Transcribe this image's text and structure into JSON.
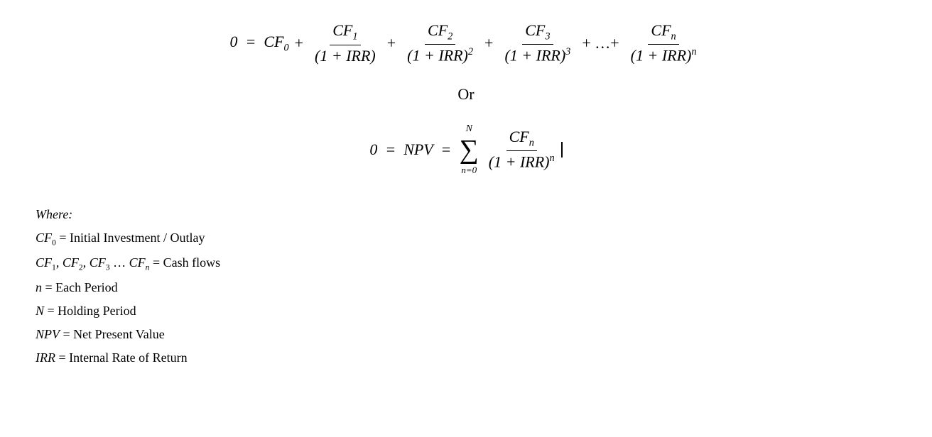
{
  "formula1": {
    "label": "0 = CF₀ + CF₁/(1+IRR) + CF₂/(1+IRR)² + CF₃/(1+IRR)³ + ... + CFₙ/(1+IRR)ⁿ"
  },
  "or_text": "Or",
  "formula2": {
    "label": "0 = NPV = Σ CFₙ/(1+IRR)ⁿ from n=0 to N"
  },
  "definitions": {
    "where_label": "Where:",
    "cf0": "CF₀ = Initial Investment / Outlay",
    "cf1n": "CF₁, CF₂, CF₃ ... CFₙ = Cash flows",
    "n_lower": "n = Each Period",
    "N_upper": "N = Holding Period",
    "NPV": "NPV = Net Present Value",
    "IRR": "IRR = Internal Rate of Return"
  }
}
